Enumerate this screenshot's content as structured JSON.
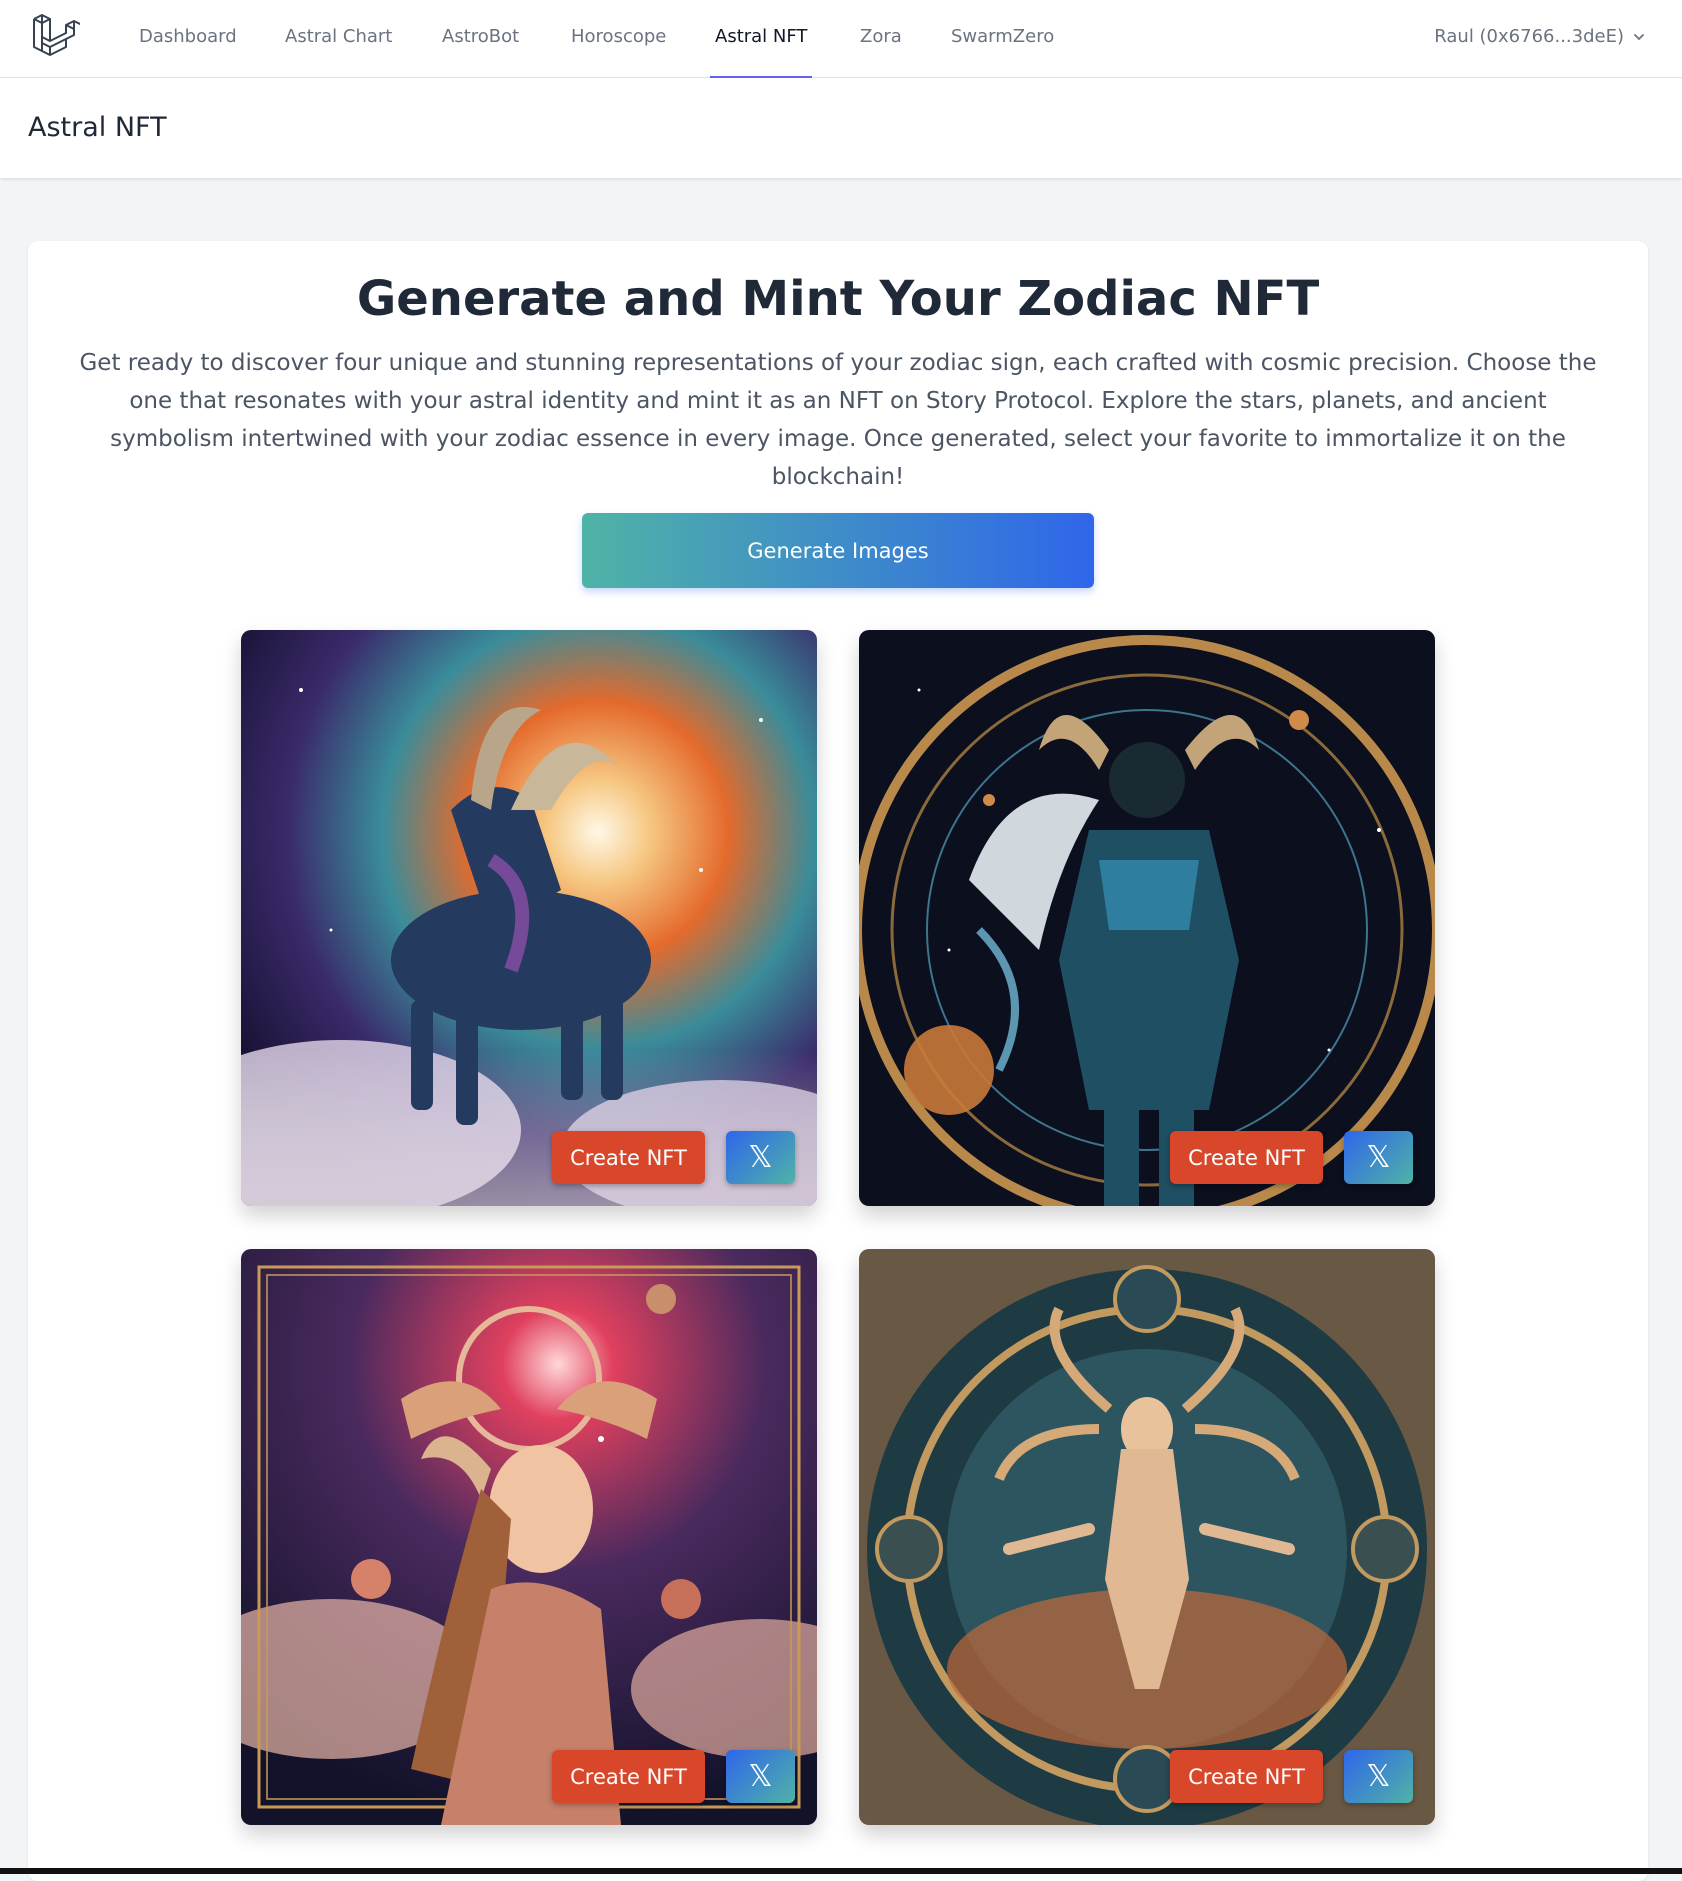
{
  "nav": {
    "items": [
      {
        "label": "Dashboard"
      },
      {
        "label": "Astral Chart"
      },
      {
        "label": "AstroBot"
      },
      {
        "label": "Horoscope"
      },
      {
        "label": "Astral NFT",
        "active": true
      },
      {
        "label": "Zora"
      },
      {
        "label": "SwarmZero"
      }
    ],
    "user": "Raul (0x6766...3deE)"
  },
  "header": {
    "title": "Astral NFT"
  },
  "main": {
    "heading": "Generate and Mint Your Zodiac NFT",
    "description": "Get ready to discover four unique and stunning representations of your zodiac sign, each crafted with cosmic precision. Choose the one that resonates with your astral identity and mint it as an NFT on Story Protocol. Explore the stars, planets, and ancient symbolism intertwined with your zodiac essence in every image. Once generated, select your favorite to immortalize it on the blockchain!",
    "generate_label": "Generate Images",
    "images": [
      {
        "create_label": "Create NFT",
        "share_label": "𝕏"
      },
      {
        "create_label": "Create NFT",
        "share_label": "𝕏"
      },
      {
        "create_label": "Create NFT",
        "share_label": "𝕏"
      },
      {
        "create_label": "Create NFT",
        "share_label": "𝕏"
      }
    ]
  },
  "colors": {
    "accent": "#6366f1",
    "create_button": "#d9472b",
    "gradient_start": "#4fb3a6",
    "gradient_end": "#2f66ea"
  }
}
